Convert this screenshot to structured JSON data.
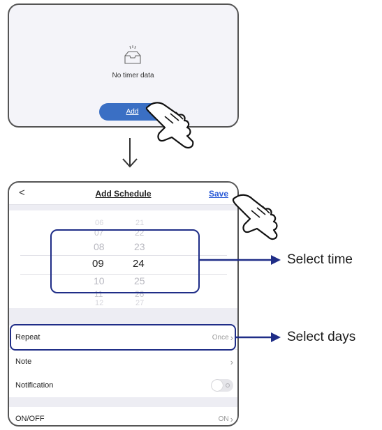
{
  "empty_state": {
    "message": "No timer data",
    "add_label": "Add"
  },
  "schedule": {
    "back_label": "<",
    "title": "Add Schedule",
    "save_label": "Save",
    "picker": {
      "hours": [
        "06",
        "07",
        "08",
        "09",
        "10",
        "11",
        "12"
      ],
      "minutes": [
        "21",
        "22",
        "23",
        "24",
        "25",
        "26",
        "27"
      ],
      "selected_hour": "09",
      "selected_minute": "24"
    },
    "rows": {
      "repeat": {
        "label": "Repeat",
        "value": "Once"
      },
      "note": {
        "label": "Note"
      },
      "notification": {
        "label": "Notification",
        "enabled": false
      },
      "onoff": {
        "label": "ON/OFF",
        "value": "ON"
      }
    }
  },
  "callouts": {
    "time": "Select time",
    "days": "Select days"
  },
  "colors": {
    "accent": "#3a6fc4",
    "save_link": "#2a5bd7",
    "callout": "#1f2d87"
  }
}
